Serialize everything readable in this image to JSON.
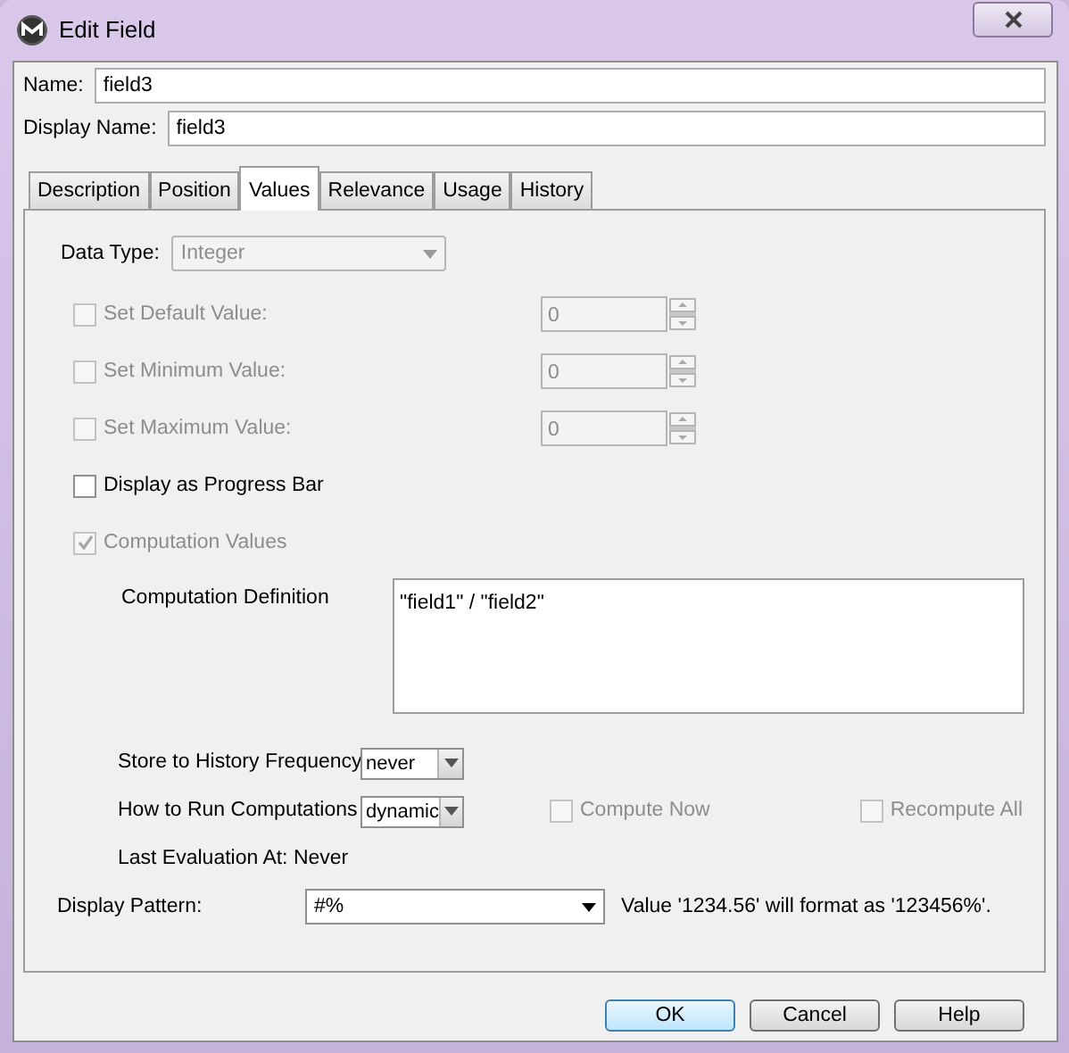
{
  "window": {
    "title": "Edit Field"
  },
  "name_field": {
    "label": "Name:",
    "value": "field3"
  },
  "display_name_field": {
    "label": "Display Name:",
    "value": "field3"
  },
  "tabs": [
    {
      "label": "Description",
      "selected": false
    },
    {
      "label": "Position",
      "selected": false
    },
    {
      "label": "Values",
      "selected": true
    },
    {
      "label": "Relevance",
      "selected": false
    },
    {
      "label": "Usage",
      "selected": false
    },
    {
      "label": "History",
      "selected": false
    }
  ],
  "data_type": {
    "label": "Data Type:",
    "value": "Integer",
    "disabled": true
  },
  "options": [
    {
      "kind": "spinner",
      "label": "Set Default Value:",
      "checked": false,
      "disabled": true,
      "value": "0"
    },
    {
      "kind": "spinner",
      "label": "Set Minimum Value:",
      "checked": false,
      "disabled": true,
      "value": "0"
    },
    {
      "kind": "spinner",
      "label": "Set Maximum Value:",
      "checked": false,
      "disabled": true,
      "value": "0"
    },
    {
      "kind": "plain",
      "label": "Display as Progress Bar",
      "checked": false,
      "disabled": false
    },
    {
      "kind": "plain",
      "label": "Computation Values",
      "checked": true,
      "disabled": true
    }
  ],
  "computation_definition": {
    "label": "Computation Definition",
    "value": "\"field1\" / \"field2\""
  },
  "history_frequency": {
    "label": "Store to History Frequency",
    "value": "never"
  },
  "run_computations": {
    "label": "How to Run Computations",
    "value": "dynamic"
  },
  "compute_now": {
    "label": "Compute Now",
    "checked": false,
    "disabled": true
  },
  "recompute_all": {
    "label": "Recompute All",
    "checked": false,
    "disabled": true
  },
  "last_evaluation": "Last Evaluation At: Never",
  "display_pattern": {
    "label": "Display Pattern:",
    "value": "#%"
  },
  "format_preview": "Value '1234.56' will format as '123456%'.",
  "buttons": [
    {
      "label": "OK",
      "default": true
    },
    {
      "label": "Cancel",
      "default": false
    },
    {
      "label": "Help",
      "default": false
    }
  ]
}
